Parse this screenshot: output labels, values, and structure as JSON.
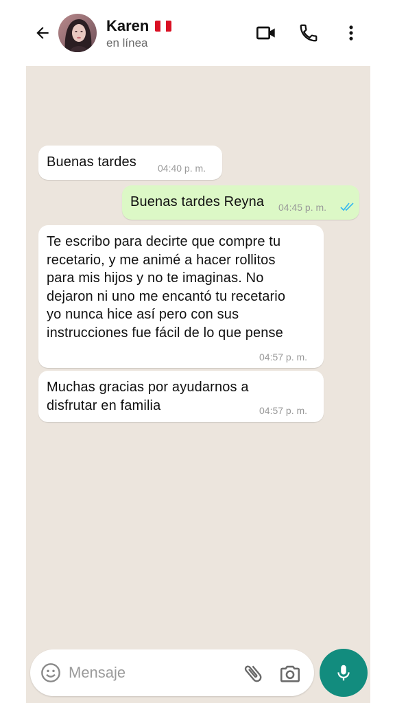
{
  "header": {
    "contact_name": "Karen",
    "status": "en línea",
    "flag_colors": [
      "#d91023",
      "#ffffff",
      "#d91023"
    ]
  },
  "messages": [
    {
      "direction": "in",
      "text": "Buenas tardes",
      "time": "04:40 p. m."
    },
    {
      "direction": "out",
      "text": "Buenas tardes Reyna",
      "time": "04:45 p. m.",
      "read": true
    },
    {
      "direction": "in",
      "text": "Te escribo para decirte que compre tu\nrecetario, y me animé a hacer rollitos\npara mis hijos y no te imaginas. No\ndejaron ni uno me encantó tu recetario\nyo nunca hice así pero con sus\ninstrucciones fue fácil de lo que pense",
      "time": "04:57 p. m."
    },
    {
      "direction": "in",
      "text": "Muchas gracias por ayudarnos a\ndisfrutar en familia",
      "time": "04:57 p. m."
    }
  ],
  "input": {
    "placeholder": "Mensaje"
  },
  "colors": {
    "accent": "#128c7e",
    "outgoing_bubble": "#dcf8c6",
    "read_ticks": "#34b7f1",
    "chat_background": "#ece5dd"
  },
  "icons": [
    "back-arrow-icon",
    "video-call-icon",
    "phone-icon",
    "more-options-icon",
    "emoji-icon",
    "attach-icon",
    "camera-icon",
    "mic-icon"
  ]
}
